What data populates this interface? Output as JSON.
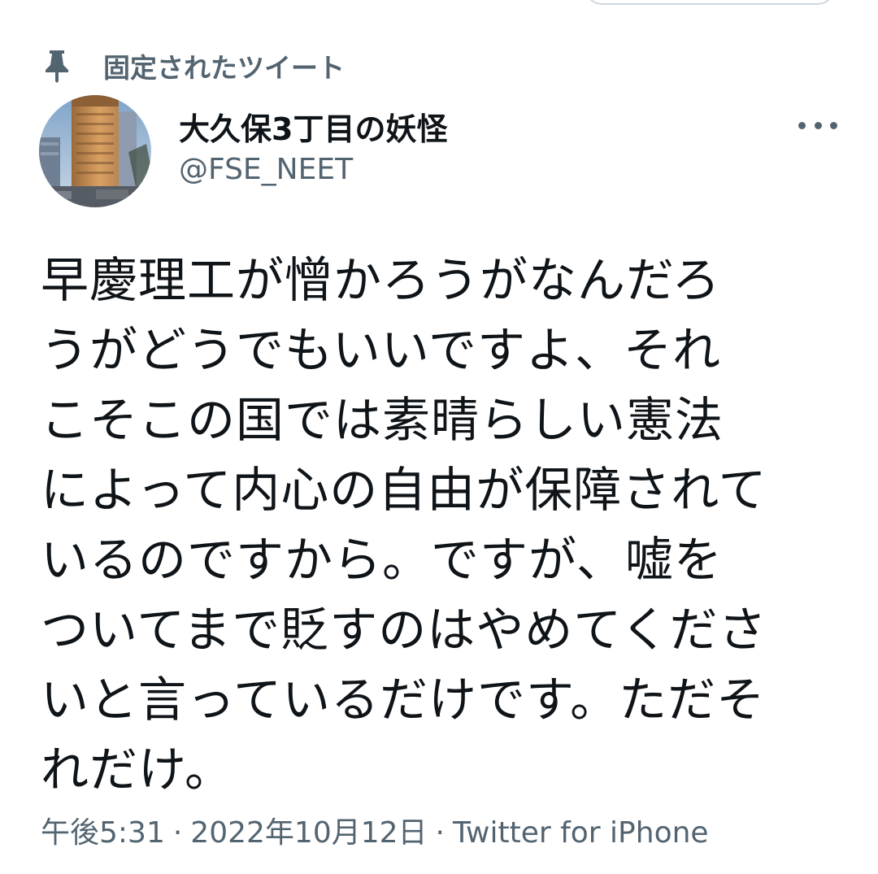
{
  "pinned": {
    "icon": "pin-icon",
    "label": "固定されたツイート"
  },
  "author": {
    "avatar": "avatar-building-photo",
    "display_name": "大久保3丁目の妖怪",
    "handle": "@FSE_NEET"
  },
  "more_icon": "more-horizontal-icon",
  "tweet": {
    "lines": [
      "早慶理工が憎かろうがなんだろ",
      "うがどうでもいいですよ、それ",
      "こそこの国では素晴らしい憲法",
      "によって内心の自由が保障されて",
      "いるのですから。ですが、嘘を",
      "ついてまで貶すのはやめてくださ",
      "いと言っているだけです。ただそ",
      "れだけ。"
    ]
  },
  "meta": {
    "time": "午後5:31",
    "separator": "·",
    "date": "2022年10月12日",
    "source": "Twitter for iPhone"
  },
  "colors": {
    "text_primary": "#0f1419",
    "text_secondary": "#536471",
    "border": "#cfd9de"
  }
}
